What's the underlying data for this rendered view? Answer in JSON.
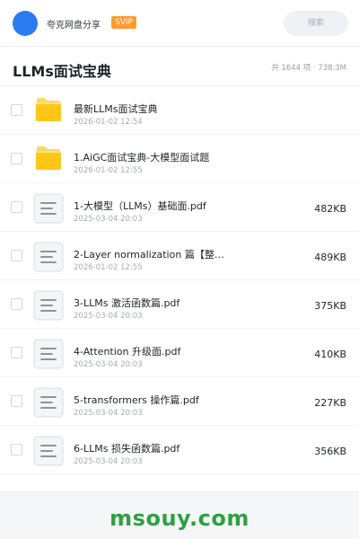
{
  "header": {
    "share_name": "夸克网盘分享",
    "vip_label": "SVIP",
    "search_placeholder": "搜索"
  },
  "folder": {
    "title": "LLMs面试宝典",
    "summary": "共 1644 项 · 738.3M"
  },
  "files": [
    {
      "type": "folder",
      "name": "最新LLMs面试宝典",
      "date": "2026-01-02 12:54",
      "size": ""
    },
    {
      "type": "folder",
      "name": "1.AiGC面试宝典-大模型面试题",
      "date": "2026-01-02 12:55",
      "size": ""
    },
    {
      "type": "file",
      "name": "1-大模型（LLMs）基础面.pdf",
      "date": "2025-03-04 20:03",
      "size": "482KB"
    },
    {
      "type": "file",
      "name": "2-Layer normalization 篇【整…",
      "date": "2026-01-02 12:55",
      "size": "489KB"
    },
    {
      "type": "file",
      "name": "3-LLMs 激活函数篇.pdf",
      "date": "2025-03-04 20:03",
      "size": "375KB"
    },
    {
      "type": "file",
      "name": "4-Attention 升级面.pdf",
      "date": "2025-03-04 20:03",
      "size": "410KB"
    },
    {
      "type": "file",
      "name": "5-transformers 操作篇.pdf",
      "date": "2025-03-04 20:03",
      "size": "227KB"
    },
    {
      "type": "file",
      "name": "6-LLMs 损失函数篇.pdf",
      "date": "2025-03-04 20:03",
      "size": "356KB"
    }
  ],
  "watermark": "msouy.com",
  "colors": {
    "accent": "#2b7bf3",
    "vip": "#ff9a2e",
    "folder": "#ffc61a",
    "watermark": "#2ea043"
  },
  "icons": {
    "folder": "folder-icon",
    "file": "document-icon"
  }
}
